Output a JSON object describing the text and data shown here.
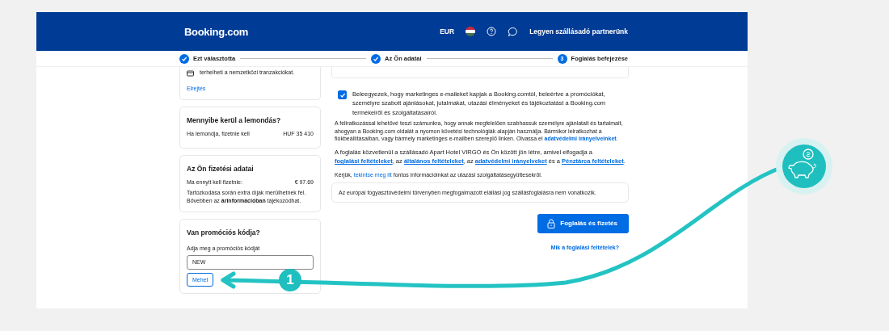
{
  "header": {
    "logo": "Booking.com",
    "currency": "EUR",
    "partner_link": "Legyen szállásadó partnerünk"
  },
  "steps": [
    {
      "label": "Ezt választotta",
      "done": true
    },
    {
      "label": "Az Ön adatai",
      "done": true
    },
    {
      "label": "Foglalás befejezése",
      "done": false,
      "number": "3"
    }
  ],
  "fee_card": {
    "text": "terhelheti a nemzetközi tranzakciókat.",
    "hide_link": "Elrejtés"
  },
  "cancel_card": {
    "title": "Mennyibe kerül a lemondás?",
    "label": "Ha lemondja, fizetnie kell",
    "amount": "HUF 35 410"
  },
  "payment_card": {
    "title": "Az Ön fizetési adatai",
    "label": "Ma ennyit kell fizetnie:",
    "amount": "€ 97.69",
    "note": "Tartózkodása során extra díjak merülhetnek fel. Bővebben az **árinformációban** tájékozódhat."
  },
  "promo_card": {
    "title": "Van promóciós kódja?",
    "field_label": "Adja meg a promóciós kódját",
    "value": "NEW",
    "button": "Mehet"
  },
  "marketing": {
    "checked": true,
    "text": "Beleegyezek, hogy marketinges e-maileket kapjak a Booking.comtól, beleértve a promóciókat, személyre szabott ajánlásokat, jutalmakat, utazási élményeket és tájékoztatást a Booking.com termékeiről és szolgáltatásairól.",
    "note": "A feliratkozással lehetővé teszi számunkra, hogy annak megfelelően szabhassuk személyre ajánlatait és tartalmait, ahogyan a Booking.com oldalát a nyomon követési technológiák alapján használja. Bármikor leiratkozhat a fiókbeállításaiban, vagy bármely marketinges e-mailben szereplő linken. Olvassa el ",
    "note_link": "adatvédelmi irányelveinket",
    "note_end": "."
  },
  "terms": [
    {
      "kind": "text",
      "text": "A foglalás közvetlenül a szállásadó Apart Hotel VIRGO és Ön között jön létre, amivel elfogadja a "
    },
    {
      "kind": "link",
      "text": "foglalási feltételeket"
    },
    {
      "kind": "text",
      "text": ", az "
    },
    {
      "kind": "link",
      "text": "általános feltételeket"
    },
    {
      "kind": "text",
      "text": ", az "
    },
    {
      "kind": "link",
      "text": "adatvédelmi irányelveket"
    },
    {
      "kind": "text",
      "text": " és a "
    },
    {
      "kind": "link",
      "text": "Pénztárca feltételeket"
    },
    {
      "kind": "text",
      "text": "."
    }
  ],
  "info": {
    "before": "Kérjük, ",
    "link": "tekintse meg itt",
    "after": " fontos információinkat az utazási szolgáltatásegyüttesekről."
  },
  "notice": "Az európai fogyasztóvédelmi törvényben megfogalmazott elállási jog szállásfoglalásra nem vonatkozik.",
  "book_button": "Foglalás és fizetés",
  "conditions_link": "Mik a foglalási feltételek?",
  "annotation": {
    "badge": "1"
  }
}
